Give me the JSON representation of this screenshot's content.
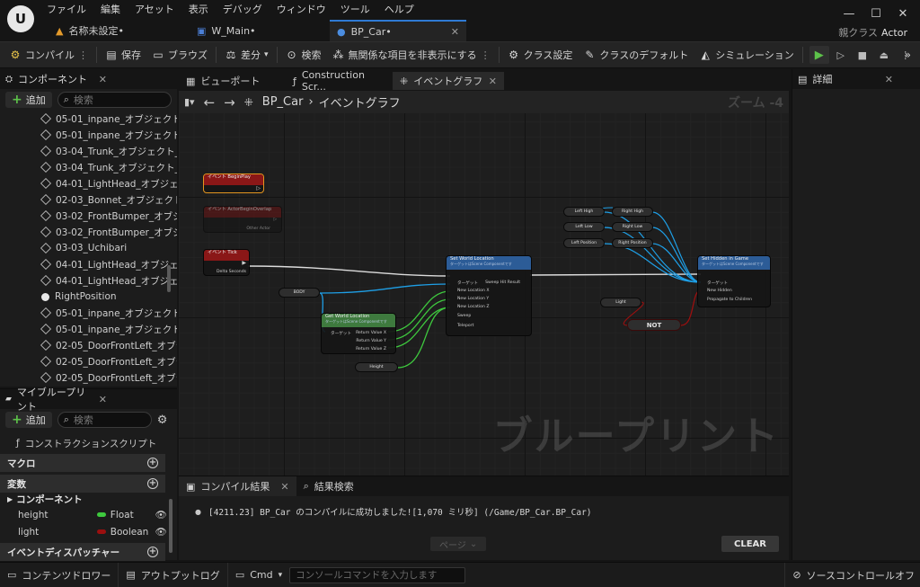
{
  "menu": [
    "ファイル",
    "編集",
    "アセット",
    "表示",
    "デバッグ",
    "ウィンドウ",
    "ツール",
    "ヘルプ"
  ],
  "doc_tabs": [
    "名称未設定•",
    "W_Main•",
    "BP_Car•"
  ],
  "parent_class": {
    "label": "親クラス",
    "value": "Actor"
  },
  "toolbar": {
    "compile": "コンパイル",
    "save": "保存",
    "browse": "ブラウズ",
    "diff": "差分",
    "find": "検索",
    "hide_unrelated": "無関係な項目を非表示にする",
    "class_settings": "クラス設定",
    "class_defaults": "クラスのデフォルト",
    "simulation": "シミュレーション"
  },
  "components_panel": {
    "title": "コンポーネント",
    "add": "追加",
    "search_placeholder": "検索",
    "items": [
      {
        "label": "05-01_inpane_オブジェクト_",
        "icon": "mesh-icon"
      },
      {
        "label": "05-01_inpane_オブジェクト_",
        "icon": "mesh-icon"
      },
      {
        "label": "03-04_Trunk_オブジェクト_9",
        "icon": "mesh-icon"
      },
      {
        "label": "03-04_Trunk_オブジェクト_1",
        "icon": "mesh-icon"
      },
      {
        "label": "04-01_LightHead_オブジェク",
        "icon": "mesh-icon"
      },
      {
        "label": "02-03_Bonnet_オブジェクト_",
        "icon": "mesh-icon"
      },
      {
        "label": "03-02_FrontBumper_オブジ:",
        "icon": "mesh-icon"
      },
      {
        "label": "03-02_FrontBumper_オブジ:",
        "icon": "mesh-icon"
      },
      {
        "label": "03-03_Uchibari",
        "icon": "mesh-icon"
      },
      {
        "label": "04-01_LightHead_オブジェク",
        "icon": "mesh-icon"
      },
      {
        "label": "04-01_LightHead_オブジェク",
        "icon": "mesh-icon"
      },
      {
        "label": "RightPosition",
        "icon": "light-bulb-icon"
      },
      {
        "label": "05-01_inpane_オブジェクト_",
        "icon": "mesh-icon"
      },
      {
        "label": "05-01_inpane_オブジェクト_",
        "icon": "mesh-icon"
      },
      {
        "label": "02-05_DoorFrontLeft_オブジ",
        "icon": "mesh-icon"
      },
      {
        "label": "02-05_DoorFrontLeft_オブジ",
        "icon": "mesh-icon"
      },
      {
        "label": "02-05_DoorFrontLeft_オブジ",
        "icon": "mesh-icon"
      }
    ]
  },
  "my_blueprint": {
    "title": "マイブループリント",
    "add": "追加",
    "search_placeholder": "検索",
    "construction_script": "コンストラクションスクリプト",
    "macros": "マクロ",
    "variables": "変数",
    "components_category": "コンポーネント",
    "vars": [
      {
        "name": "height",
        "type": "Float",
        "color": "#3ec93e"
      },
      {
        "name": "light",
        "type": "Boolean",
        "color": "#9b0f0f"
      }
    ],
    "event_dispatchers": "イベントディスパッチャー"
  },
  "editor_tabs": [
    "ビューポート",
    "Construction Scr...",
    "イベントグラフ"
  ],
  "breadcrumb": {
    "root": "BP_Car",
    "current": "イベントグラフ"
  },
  "zoom_label": "ズーム -4",
  "graph": {
    "watermark": "ブループリント",
    "nodes": {
      "begin_play": "イベント BeginPlay",
      "begin_overlap": "イベント ActorBeginOverlap",
      "other_actor": "Other Actor",
      "tick": "イベント Tick",
      "delta_seconds": "Delta Seconds",
      "set_world_location": "Set World Location",
      "set_world_location_sub": "ターゲットはScene Componentです",
      "target": "ターゲット",
      "new_location_x": "New Location X",
      "new_location_y": "New Location Y",
      "new_location_z": "New Location Z",
      "sweep": "Sweep",
      "teleport": "Teleport",
      "sweep_hit_result": "Sweep Hit Result",
      "body": "BODY",
      "get_world_location": "Get World Location",
      "get_world_location_sub": "ターゲットはScene Componentです",
      "return_x": "Return Value X",
      "return_y": "Return Value Y",
      "return_z": "Return Value Z",
      "height": "Height",
      "left_high": "Left High",
      "right_high": "Right High",
      "left_low": "Left Low",
      "right_low": "Right Low",
      "left_position": "Left Position",
      "right_position": "Right Position",
      "set_hidden": "Set Hidden in Game",
      "set_hidden_sub": "ターゲットはScene Componentです",
      "new_hidden": "New Hidden",
      "propagate": "Propagate to Children",
      "light": "Light",
      "not": "NOT"
    }
  },
  "results": {
    "tab_compile": "コンパイル結果",
    "tab_search": "結果検索",
    "message": "[4211.23] BP_Car のコンパイルに成功しました![1,070 ミリ秒] (/Game/BP_Car.BP_Car)",
    "page_button": "ページ",
    "clear_button": "CLEAR"
  },
  "details": {
    "title": "詳細"
  },
  "statusbar": {
    "content_drawer": "コンテンツドロワー",
    "output_log": "アウトプットログ",
    "cmd": "Cmd",
    "console_placeholder": "コンソールコマンドを入力します",
    "source_control": "ソースコントロールオフ"
  },
  "colors": {
    "accent": "#2f7ad4",
    "exec_wire": "#dcdcdc",
    "object_wire": "#1e9fe6",
    "float_wire": "#3ec93e",
    "bool_wire": "#9b0f0f",
    "play_active": "#5dc24a"
  }
}
